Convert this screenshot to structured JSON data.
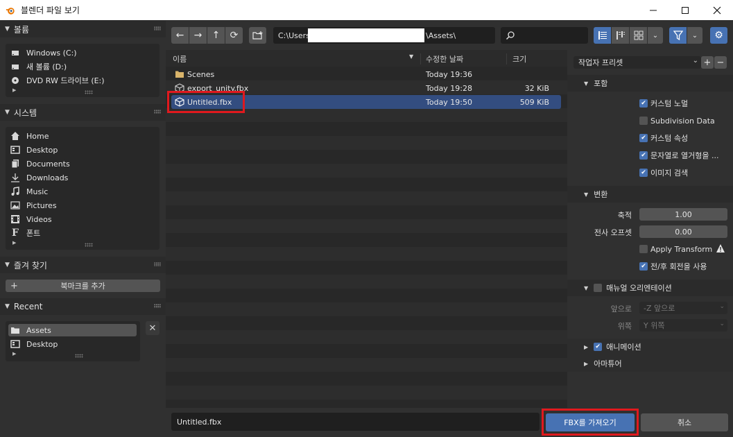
{
  "window": {
    "title": "블렌더 파일 보기",
    "minimize_icon": "minimize-icon",
    "maximize_icon": "maximize-icon",
    "close_icon": "close-icon"
  },
  "sidebar": {
    "volumes": {
      "header": "볼륨",
      "items": [
        {
          "label": "Windows (C:)",
          "icon": "drive-icon"
        },
        {
          "label": "새 볼륨 (D:)",
          "icon": "drive-icon"
        },
        {
          "label": "DVD RW 드라이브 (E:)",
          "icon": "disc-icon"
        }
      ]
    },
    "system": {
      "header": "시스템",
      "items": [
        {
          "label": "Home",
          "icon": "home-icon"
        },
        {
          "label": "Desktop",
          "icon": "desktop-icon"
        },
        {
          "label": "Documents",
          "icon": "documents-icon"
        },
        {
          "label": "Downloads",
          "icon": "download-icon"
        },
        {
          "label": "Music",
          "icon": "music-icon"
        },
        {
          "label": "Pictures",
          "icon": "pictures-icon"
        },
        {
          "label": "Videos",
          "icon": "videos-icon"
        },
        {
          "label": "폰트",
          "icon": "font-icon"
        }
      ]
    },
    "favorites": {
      "header": "즐겨 찾기",
      "add_bookmark": "북마크를 추가"
    },
    "recent": {
      "header": "Recent",
      "items": [
        {
          "label": "Assets",
          "icon": "folder-icon",
          "selected": true
        },
        {
          "label": "Desktop",
          "icon": "desktop-icon",
          "selected": false
        }
      ]
    }
  },
  "toolbar": {
    "path_prefix": "C:\\Users\\",
    "path_suffix": "\\Assets\\",
    "search_value": ""
  },
  "filelist": {
    "columns": {
      "name": "이름",
      "date": "수정한 날짜",
      "size": "크기"
    },
    "rows": [
      {
        "name": "Scenes",
        "date": "Today 19:36",
        "size": "",
        "icon": "folder-icon",
        "selected": false
      },
      {
        "name": "export_unity.fbx",
        "date": "Today 19:28",
        "size": "32 KiB",
        "icon": "mesh-file-icon",
        "selected": false
      },
      {
        "name": "Untitled.fbx",
        "date": "Today 19:50",
        "size": "509 KiB",
        "icon": "mesh-file-icon",
        "selected": true
      }
    ]
  },
  "bottombar": {
    "filename": "Untitled.fbx",
    "import_label": "FBX를 가져오기",
    "cancel_label": "취소"
  },
  "options": {
    "preset_label": "작업자 프리셋",
    "include": {
      "header": "포함",
      "custom_normals": "커스텀 노멀",
      "custom_normals_checked": true,
      "subdivision": "Subdivision Data",
      "subdivision_checked": false,
      "custom_props": "커스텀 속성",
      "custom_props_checked": true,
      "enum_string": "문자열로 열거형을 ...",
      "enum_string_checked": true,
      "image_search": "이미지 검색",
      "image_search_checked": true
    },
    "transform": {
      "header": "변환",
      "scale_label": "축적",
      "scale_value": "1.00",
      "offset_label": "전사 오프셋",
      "offset_value": "0.00",
      "apply_transform": "Apply Transform",
      "apply_transform_checked": false,
      "prepost_rotation": "전/후 회전을 사용",
      "prepost_rotation_checked": true
    },
    "manual_orientation": {
      "header": "매뉴얼 오리엔테이션",
      "checked": false,
      "forward_label": "앞으로",
      "forward_value": "-Z 앞으로",
      "up_label": "위쪽",
      "up_value": "Y 위쪽"
    },
    "animation": {
      "header": "애니메이션",
      "checked": true
    },
    "armature": {
      "header": "아마튜어"
    }
  },
  "colors": {
    "accent": "#4772b3",
    "selection": "#334d80",
    "highlight_box": "#e0191e"
  }
}
